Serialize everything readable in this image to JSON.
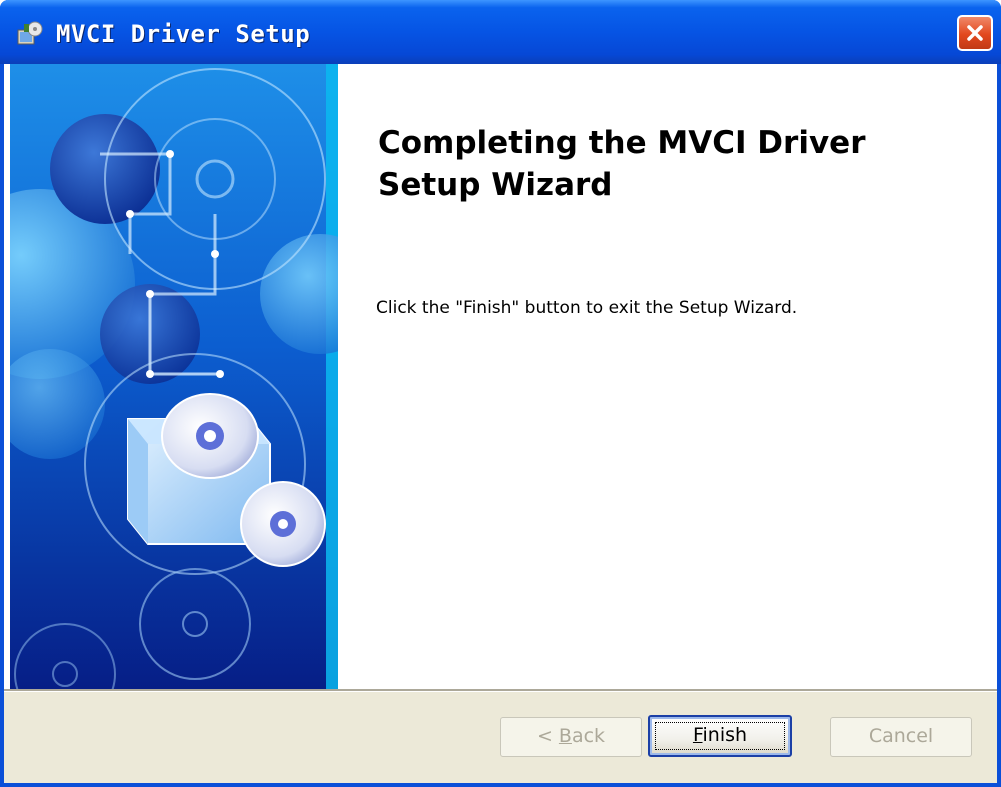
{
  "window": {
    "title": "MVCI Driver Setup",
    "accent": "#0654E4",
    "close_color": "#E2481E"
  },
  "main": {
    "heading": "Completing the MVCI Driver Setup Wizard",
    "description": "Click the \"Finish\" button to exit the Setup Wizard."
  },
  "buttons": {
    "back": {
      "prefix": "< ",
      "mnemonic": "B",
      "rest": "ack",
      "enabled": false
    },
    "finish": {
      "mnemonic": "F",
      "rest": "inish",
      "enabled": true,
      "default": true
    },
    "cancel": {
      "label": "Cancel",
      "enabled": false
    }
  },
  "icons": {
    "title": "installer-icon",
    "close": "close-icon",
    "banner": "cd-box-banner-graphic"
  }
}
